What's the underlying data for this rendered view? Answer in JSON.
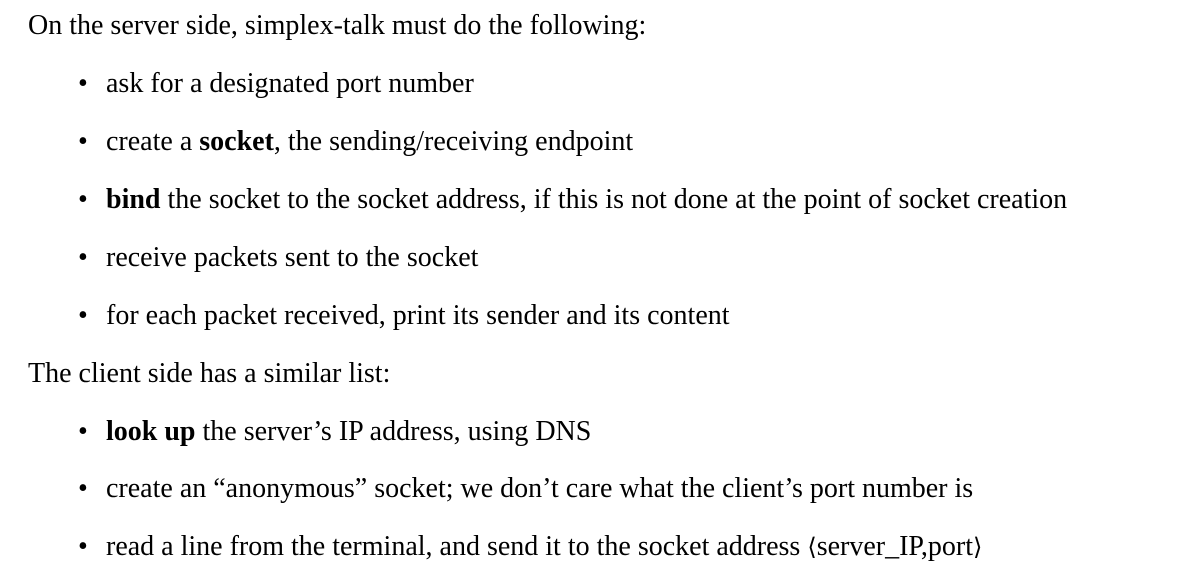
{
  "server": {
    "intro": "On the server side, simplex-talk must do the following:",
    "items": [
      {
        "text": "ask for a designated port number"
      },
      {
        "pre": "create a ",
        "bold": "socket",
        "post": ", the sending/receiving endpoint"
      },
      {
        "bold": "bind",
        "post": " the socket to the socket address, if this is not done at the point of socket creation"
      },
      {
        "text": "receive packets sent to the socket"
      },
      {
        "text": "for each packet received, print its sender and its content"
      }
    ]
  },
  "client": {
    "intro": "The client side has a similar list:",
    "items": [
      {
        "bold": "look up",
        "post": " the server’s IP address, using DNS"
      },
      {
        "text": "create an “anonymous” socket; we don’t care what the client’s port number is"
      },
      {
        "pre": "read a line from the terminal, and send it to the socket address ",
        "lang": "⟨",
        "addr": "server_IP,port",
        "rang": "⟩"
      }
    ]
  },
  "bullet_glyph": "•"
}
